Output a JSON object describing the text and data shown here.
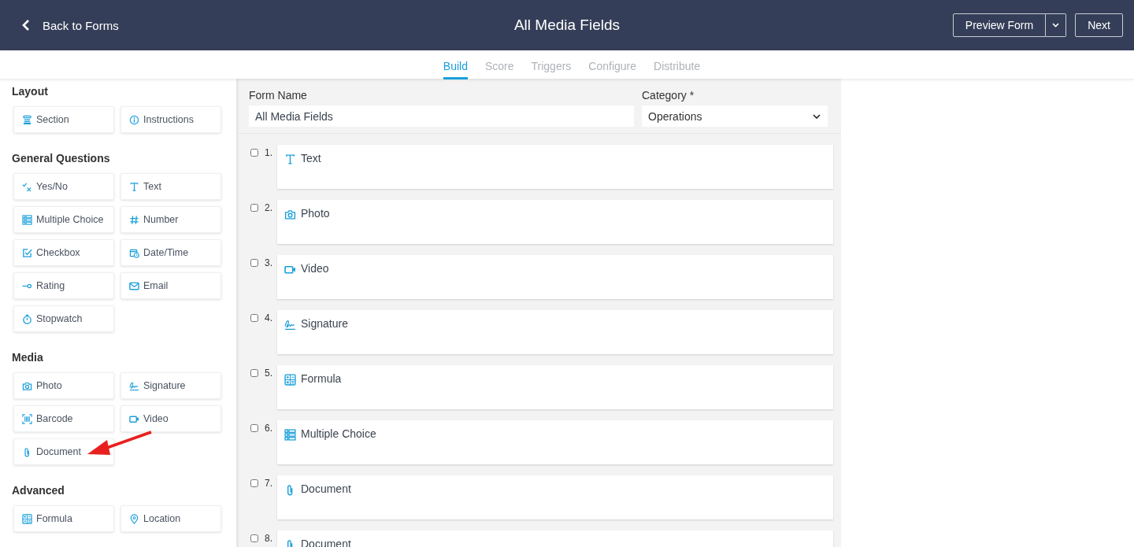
{
  "header": {
    "back_label": "Back to Forms",
    "title": "All Media Fields",
    "preview_button": "Preview Form",
    "next_button": "Next"
  },
  "tabs": [
    {
      "label": "Build",
      "selected": true
    },
    {
      "label": "Score",
      "selected": false
    },
    {
      "label": "Triggers",
      "selected": false
    },
    {
      "label": "Configure",
      "selected": false
    },
    {
      "label": "Distribute",
      "selected": false
    }
  ],
  "sidebar": {
    "groups": [
      {
        "title": "Layout",
        "items": [
          {
            "label": "Section",
            "kind": "section"
          },
          {
            "label": "Instructions",
            "kind": "info"
          }
        ]
      },
      {
        "title": "General Questions",
        "items": [
          {
            "label": "Yes/No",
            "kind": "yesno"
          },
          {
            "label": "Text",
            "kind": "text"
          },
          {
            "label": "Multiple Choice",
            "kind": "choice"
          },
          {
            "label": "Number",
            "kind": "number"
          },
          {
            "label": "Checkbox",
            "kind": "checkbox"
          },
          {
            "label": "Date/Time",
            "kind": "date"
          },
          {
            "label": "Rating",
            "kind": "rating"
          },
          {
            "label": "Email",
            "kind": "email"
          },
          {
            "label": "Stopwatch",
            "kind": "stopwatch"
          }
        ]
      },
      {
        "title": "Media",
        "items": [
          {
            "label": "Photo",
            "kind": "photo"
          },
          {
            "label": "Signature",
            "kind": "signature"
          },
          {
            "label": "Barcode",
            "kind": "barcode"
          },
          {
            "label": "Video",
            "kind": "video"
          },
          {
            "label": "Document",
            "kind": "document"
          }
        ]
      },
      {
        "title": "Advanced",
        "items": [
          {
            "label": "Formula",
            "kind": "formula"
          },
          {
            "label": "Location",
            "kind": "location"
          }
        ]
      }
    ]
  },
  "form": {
    "name_label": "Form Name",
    "name_value": "All Media Fields",
    "category_label": "Category *",
    "category_value": "Operations"
  },
  "questions": [
    {
      "number": "1.",
      "label": "Text",
      "kind": "text",
      "checked": false
    },
    {
      "number": "2.",
      "label": "Photo",
      "kind": "photo",
      "checked": false
    },
    {
      "number": "3.",
      "label": "Video",
      "kind": "video",
      "checked": false
    },
    {
      "number": "4.",
      "label": "Signature",
      "kind": "signature",
      "checked": false
    },
    {
      "number": "5.",
      "label": "Formula",
      "kind": "formula",
      "checked": false
    },
    {
      "number": "6.",
      "label": "Multiple Choice",
      "kind": "choice",
      "checked": false
    },
    {
      "number": "7.",
      "label": "Document",
      "kind": "document",
      "checked": false
    },
    {
      "number": "8.",
      "label": "Document",
      "kind": "document",
      "checked": false
    }
  ]
}
